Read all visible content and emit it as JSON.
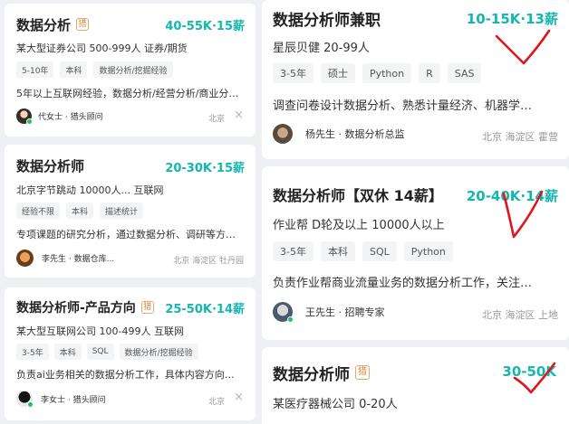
{
  "left_cards": [
    {
      "title": "数据分析",
      "hunter_badge": "猎",
      "salary": "40-55K·15薪",
      "company": "某大型证券公司 500-999人 证券/期货",
      "tags": [
        "5-10年",
        "本科",
        "数据分析/挖掘经验"
      ],
      "description": "5年以上互联网经验，数据分析/经营分析/商业分…",
      "recruiter": "代女士 · 猎头顾问",
      "location": "北京"
    },
    {
      "title": "数据分析师",
      "salary": "20-30K·15薪",
      "company": "北京字节跳动 10000人... 互联网",
      "tags": [
        "经验不限",
        "本科",
        "描述统计"
      ],
      "description": "专项课题的研究分析，通过数据分析、调研等方…",
      "recruiter": "李先生 · 数据仓库...",
      "location": "北京 海淀区 牡丹园"
    },
    {
      "title": "数据分析师-产品方向",
      "hunter_badge": "猎",
      "salary": "25-50K·14薪",
      "company": "某大型互联网公司 100-499人 互联网",
      "tags": [
        "3-5年",
        "本科",
        "SQL",
        "数据分析/挖掘经验"
      ],
      "description": "负责ai业务相关的数据分析工作，具体内容方向…",
      "recruiter": "李女士 · 猎头顾问",
      "location": "北京"
    }
  ],
  "right_cards": [
    {
      "title": "数据分析师兼职",
      "salary": "10-15K·13薪",
      "company": "星辰贝健 20-99人",
      "tags": [
        "3-5年",
        "硕士",
        "Python",
        "R",
        "SAS"
      ],
      "description": "调查问卷设计数据分析、熟悉计量经济、机器学…",
      "recruiter": "杨先生 · 数据分析总监",
      "location": "北京 海淀区 霍营"
    },
    {
      "title": "数据分析师【双休 14薪】",
      "salary": "20-40K·14薪",
      "company": "作业帮 D轮及以上 10000人以上",
      "tags": [
        "3-5年",
        "本科",
        "SQL",
        "Python"
      ],
      "description": "负责作业帮商业流量业务的数据分析工作，关注…",
      "recruiter": "王先生 · 招聘专家",
      "location": "北京 海淀区 上地"
    },
    {
      "title": "数据分析师",
      "hunter_badge": "猎",
      "salary": "30-50K",
      "company": "某医疗器械公司 0-20人"
    }
  ],
  "close_glyph": "×",
  "colors": {
    "salary": "#14b7b0",
    "hunter_badge": "#d6873f",
    "online": "#22c35e",
    "annotation": "#e0141e"
  }
}
